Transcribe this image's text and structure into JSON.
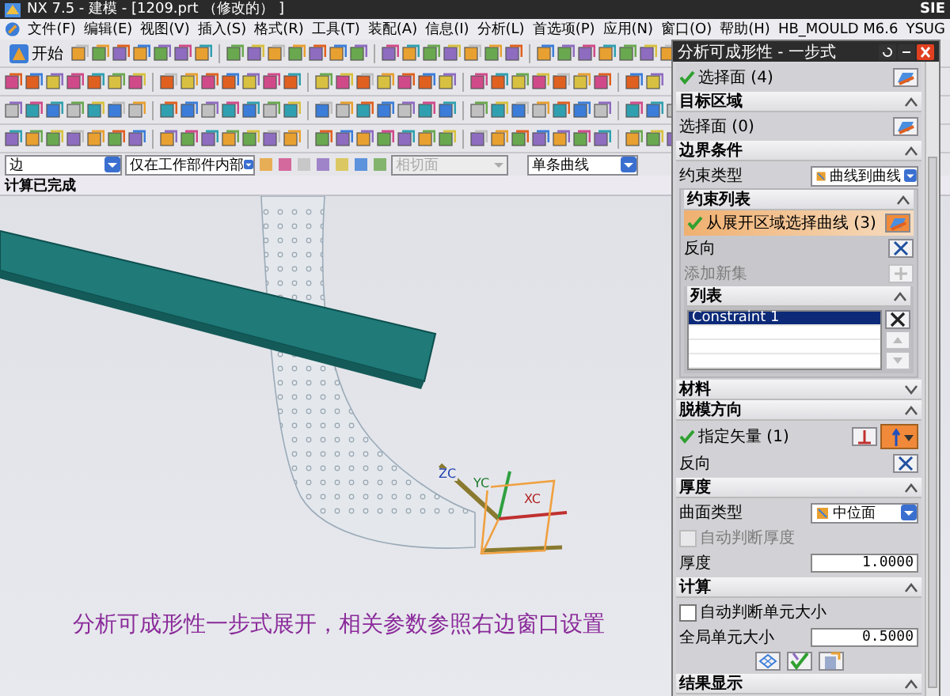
{
  "window": {
    "title": "NX 7.5 - 建模 - [1209.prt （修改的） ]",
    "vendor": "SIE"
  },
  "menu": [
    {
      "label": "文件(F)"
    },
    {
      "label": "编辑(E)"
    },
    {
      "label": "视图(V)"
    },
    {
      "label": "插入(S)"
    },
    {
      "label": "格式(R)"
    },
    {
      "label": "工具(T)"
    },
    {
      "label": "装配(A)"
    },
    {
      "label": "信息(I)"
    },
    {
      "label": "分析(L)"
    },
    {
      "label": "首选项(P)"
    },
    {
      "label": "应用(N)"
    },
    {
      "label": "窗口(O)"
    },
    {
      "label": "帮助(H)"
    },
    {
      "label": "HB_MOULD M6.6"
    },
    {
      "label": "YSUG"
    }
  ],
  "start_button": {
    "label": "开始"
  },
  "selection_bar": [
    {
      "value": "边",
      "disabled": false
    },
    {
      "value": "仅在工作部件内部",
      "disabled": false
    },
    {
      "value": "相切面",
      "disabled": true
    },
    {
      "value": "单条曲线",
      "disabled": false
    }
  ],
  "status_bar": {
    "text": "计算已完成"
  },
  "viewport": {
    "axis_labels": [
      "ZC",
      "YC",
      "XC"
    ],
    "caption": "分析可成形性一步式展开，相关参数参照右边窗口设置"
  },
  "dialog": {
    "title": "分析可成形性 - 一步式",
    "sections": [
      {
        "rows": [
          {
            "kind": "select",
            "label": "选择面 (4)",
            "checked": true,
            "active": false
          }
        ]
      },
      {
        "title": "目标区域",
        "expanded": true,
        "rows": [
          {
            "kind": "select",
            "label": "选择面 (0)",
            "checked": false,
            "active": false
          }
        ]
      },
      {
        "title": "边界条件",
        "expanded": true,
        "rows": [
          {
            "kind": "dropdown",
            "label": "约束类型",
            "value": "曲线到曲线"
          },
          {
            "kind": "subsection",
            "title": "约束列表",
            "expanded": true,
            "rows": [
              {
                "kind": "select",
                "label": "从展开区域选择曲线 (3)",
                "checked": true,
                "active": true
              },
              {
                "kind": "button",
                "label": "反向",
                "disabled": false
              },
              {
                "kind": "button",
                "label": "添加新集",
                "disabled": true
              },
              {
                "kind": "list",
                "title": "列表",
                "expanded": true,
                "items": [
                  {
                    "label": "Constraint 1",
                    "selected": true
                  }
                ]
              }
            ]
          }
        ]
      },
      {
        "title": "材料",
        "expanded": false
      },
      {
        "title": "脱模方向",
        "expanded": true,
        "rows": [
          {
            "kind": "vector",
            "label": "指定矢量 (1)",
            "checked": true
          },
          {
            "kind": "button",
            "label": "反向",
            "disabled": false
          }
        ]
      },
      {
        "title": "厚度",
        "expanded": true,
        "rows": [
          {
            "kind": "dropdown",
            "label": "曲面类型",
            "value": "中位面"
          },
          {
            "kind": "checkbox",
            "label": "自动判断厚度",
            "checked": false,
            "disabled": true
          },
          {
            "kind": "number",
            "label": "厚度",
            "value": "1.0000"
          }
        ]
      },
      {
        "title": "计算",
        "expanded": true,
        "rows": [
          {
            "kind": "checkbox",
            "label": "自动判断单元大小",
            "checked": false,
            "disabled": false
          },
          {
            "kind": "number",
            "label": "全局单元大小",
            "value": "0.5000"
          },
          {
            "kind": "actions"
          }
        ]
      },
      {
        "title": "结果显示",
        "expanded": true
      }
    ]
  }
}
